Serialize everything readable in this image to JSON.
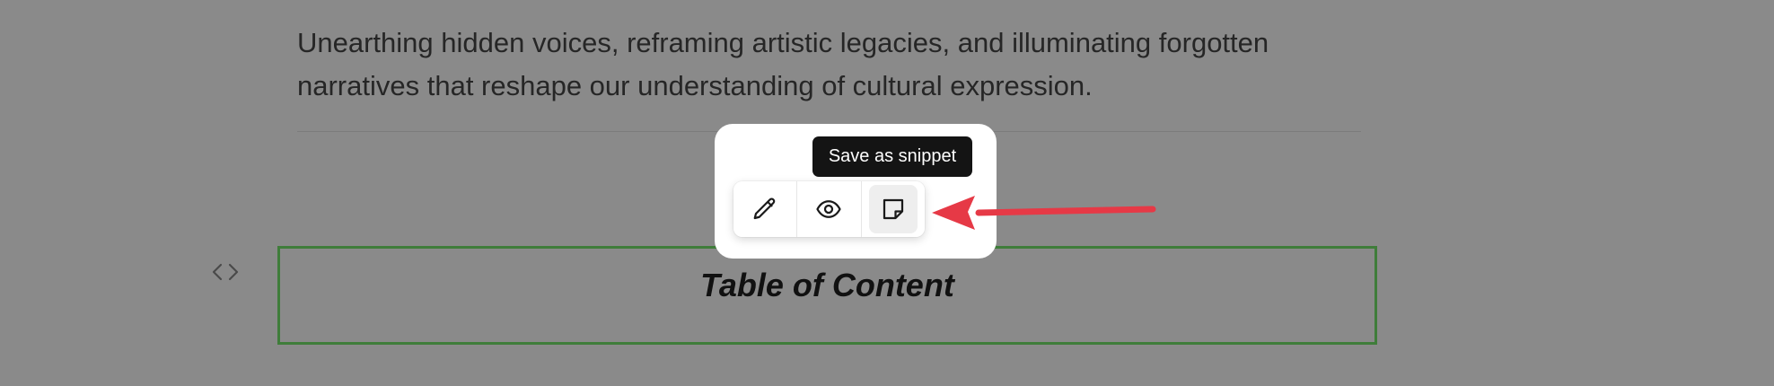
{
  "intro": {
    "line1": "Unearthing hidden voices, reframing artistic legacies, and illuminating forgotten",
    "line2": "narratives that reshape our understanding of cultural expression."
  },
  "toolbar": {
    "tooltip": "Save as snippet",
    "buttons": [
      {
        "icon": "pencil-icon",
        "name": "edit-button"
      },
      {
        "icon": "eye-icon",
        "name": "preview-button"
      },
      {
        "icon": "sticky-note-icon",
        "name": "save-snippet-button"
      }
    ]
  },
  "section": {
    "title": "Table of Content"
  },
  "colors": {
    "overlay": "#8a8a8a",
    "section_border": "#3f7d3a",
    "arrow": "#e63946",
    "tooltip_bg": "#141414"
  }
}
